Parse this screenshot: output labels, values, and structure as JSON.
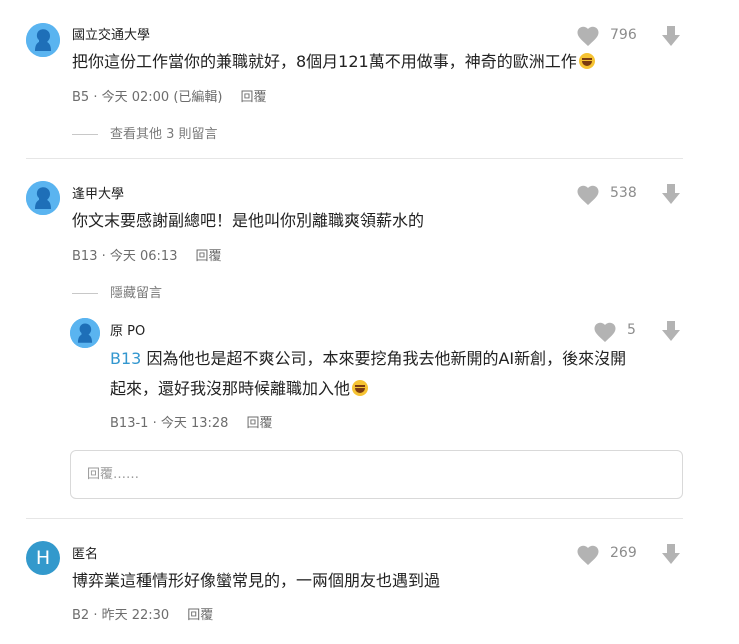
{
  "comments": [
    {
      "author": "國立交通大學",
      "content": "把你這份工作當你的兼職就好，8個月121萬不用做事，神奇的歐洲工作",
      "floor": "B5",
      "time": "今天 02:00 (已編輯)",
      "likes": "796",
      "reply_label": "回覆",
      "toggle_label": "查看其他 3 則留言"
    },
    {
      "author": "逢甲大學",
      "content": "你文末要感謝副總吧！是他叫你別離職爽領薪水的",
      "floor": "B13",
      "time": "今天 06:13",
      "likes": "538",
      "reply_label": "回覆",
      "toggle_label": "隱藏留言"
    },
    {
      "author": "匿名",
      "avatar_letter": "H",
      "content": "博弈業這種情形好像蠻常見的，一兩個朋友也遇到過",
      "floor": "B2",
      "time": "昨天 22:30",
      "likes": "269",
      "reply_label": "回覆"
    }
  ],
  "reply": {
    "author": "原 PO",
    "mention": "B13",
    "content_line1": "因為他也是超不爽公司，本來要挖角我去他新開的AI新創，後來沒開",
    "content_line2": "起來，還好我沒那時候離職加入他",
    "floor": "B13-1",
    "time": "今天 13:28",
    "likes": "5",
    "reply_label": "回覆"
  },
  "reply_box": {
    "placeholder": "回覆……"
  },
  "colors": {
    "avatar": "#5ab4f0",
    "avatar_h": "#3399cc",
    "mention": "#3397cf",
    "icon": "#b3b3b3"
  },
  "icons": [
    "avatar-silhouette-icon",
    "heart-icon",
    "downvote-arrow-icon",
    "laughing-emoji-icon"
  ]
}
